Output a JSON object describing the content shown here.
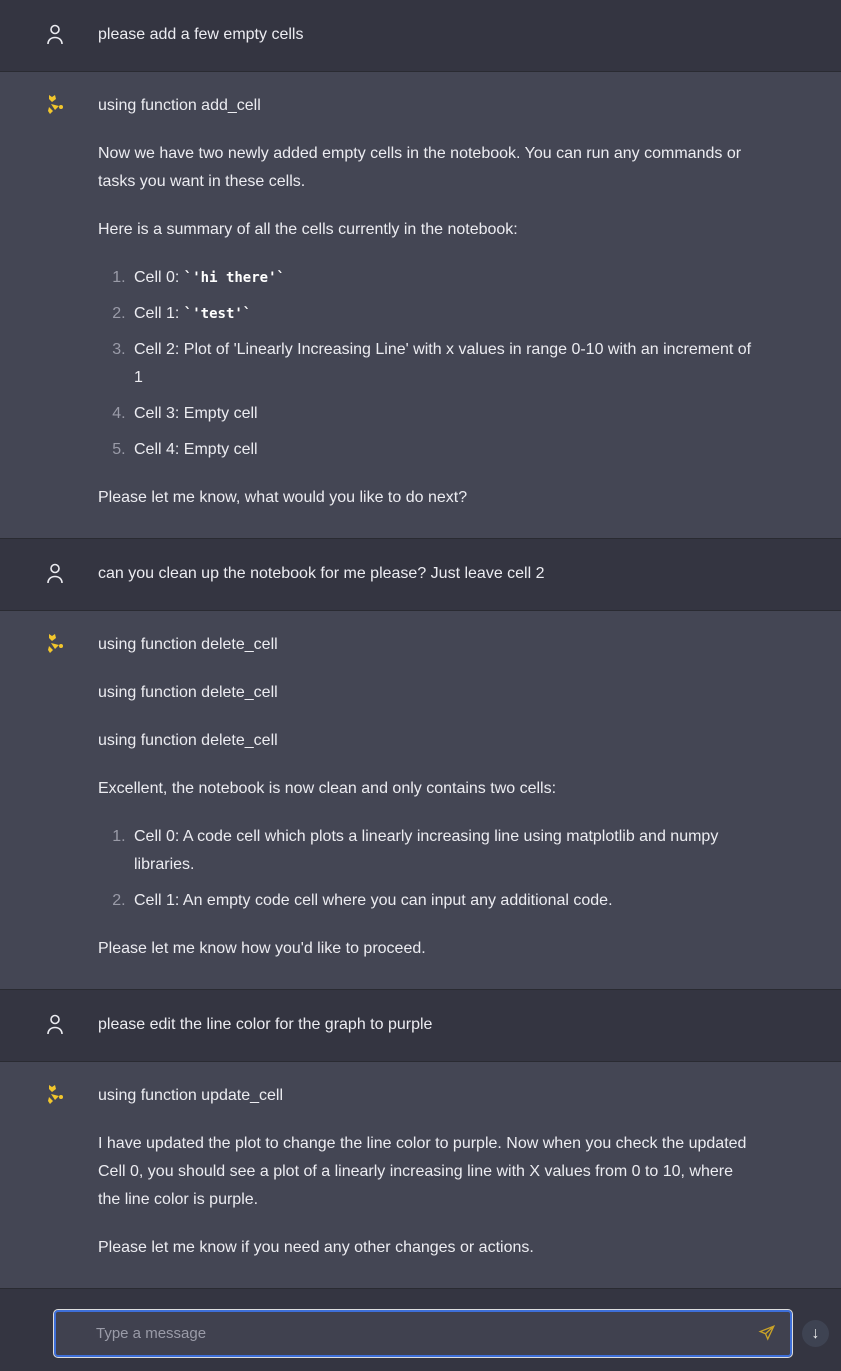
{
  "colors": {
    "user_bg": "#343541",
    "assistant_bg": "#444654",
    "accent": "#f2c62c",
    "input_border": "#3e6fd8"
  },
  "messages": [
    {
      "role": "user",
      "text": "please add a few empty cells"
    },
    {
      "role": "assistant",
      "paragraphs_before": [
        "using function add_cell",
        "Now we have two newly added empty cells in the notebook. You can run any commands or tasks you want in these cells.",
        "Here is a summary of all the cells currently in the notebook:"
      ],
      "list": [
        {
          "label": "Cell 0: ",
          "code": "`'hi there'`"
        },
        {
          "label": "Cell 1: ",
          "code": "`'test'`"
        },
        {
          "label": "Cell 2: Plot of 'Linearly Increasing Line' with x values in range 0-10 with an increment of 1"
        },
        {
          "label": "Cell 3: Empty cell"
        },
        {
          "label": "Cell 4: Empty cell"
        }
      ],
      "paragraphs_after": [
        "Please let me know, what would you like to do next?"
      ]
    },
    {
      "role": "user",
      "text": "can you clean up the notebook for me please? Just leave cell 2"
    },
    {
      "role": "assistant",
      "paragraphs_before": [
        "using function delete_cell",
        "using function delete_cell",
        "using function delete_cell",
        "Excellent, the notebook is now clean and only contains two cells:"
      ],
      "list": [
        {
          "label": "Cell 0: A code cell which plots a linearly increasing line using matplotlib and numpy libraries."
        },
        {
          "label": "Cell 1: An empty code cell where you can input any additional code."
        }
      ],
      "paragraphs_after": [
        "Please let me know how you'd like to proceed."
      ]
    },
    {
      "role": "user",
      "text": "please edit the line color for the graph to purple"
    },
    {
      "role": "assistant",
      "paragraphs_before": [
        "using function update_cell",
        "I have updated the plot to change the line color to purple. Now when you check the updated Cell 0, you should see a plot of a linearly increasing line with X values from 0 to 10, where the line color is purple.",
        "Please let me know if you need any other changes or actions."
      ]
    }
  ],
  "input": {
    "placeholder": "Type a message",
    "value": ""
  },
  "icons": {
    "user": "user-icon",
    "assistant": "bot-logo-icon",
    "send": "send-icon",
    "scroll": "arrow-down-icon"
  }
}
